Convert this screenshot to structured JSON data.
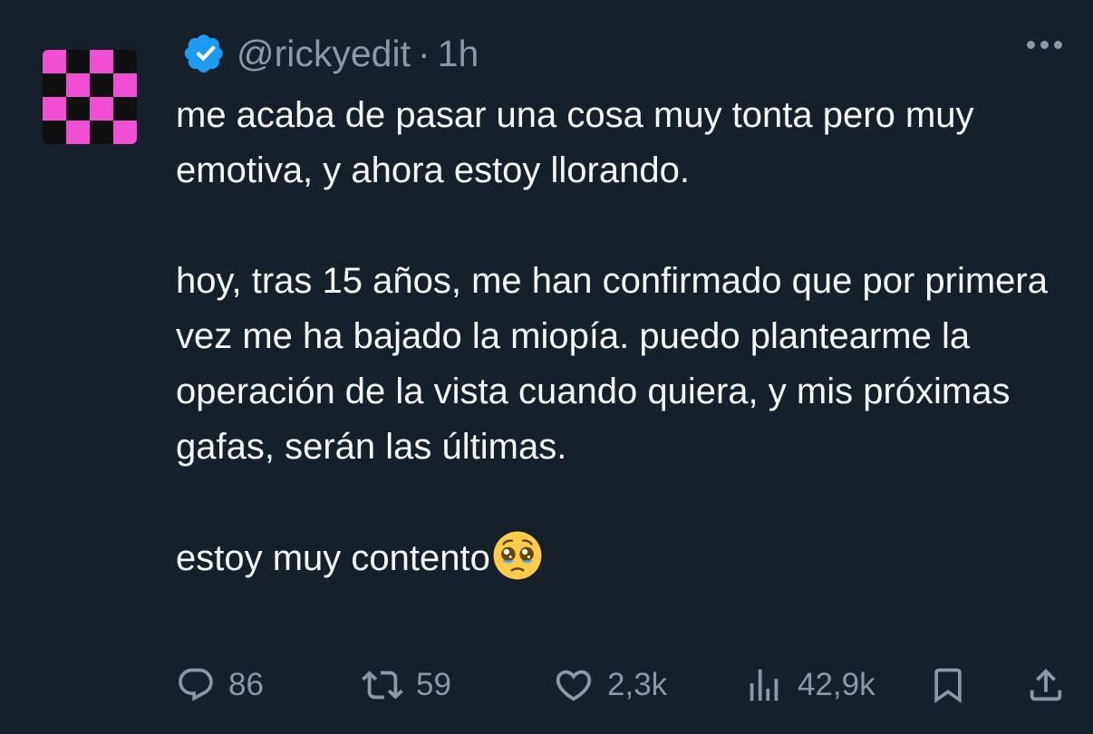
{
  "tweet": {
    "handle": "@rickyedit",
    "separator": "·",
    "time": "1h",
    "paragraphs": [
      "me acaba de pasar una cosa muy tonta pero muy emotiva, y ahora estoy llorando.",
      "hoy, tras 15 años, me han confirmado que por primera vez me ha bajado la miopía. puedo plantearme la operación de la vista cuando quiera, y mis próximas gafas, serán las últimas.",
      "estoy muy contento"
    ],
    "end_emoji": "pleading-face-emoji"
  },
  "actions": {
    "replies": "86",
    "retweets": "59",
    "likes": "2,3k",
    "views": "42,9k"
  },
  "icons": {
    "verified": "verified-badge-icon",
    "more": "more-options-icon",
    "reply": "reply-icon",
    "retweet": "retweet-icon",
    "like": "heart-icon",
    "views": "views-icon",
    "bookmark": "bookmark-icon",
    "share": "share-icon"
  },
  "colors": {
    "background": "#15202b",
    "text": "#f7f9f9",
    "secondary": "#8b98a5",
    "verified": "#1d9bf0",
    "avatar_pink": "#f14fd3",
    "avatar_black": "#101010"
  }
}
